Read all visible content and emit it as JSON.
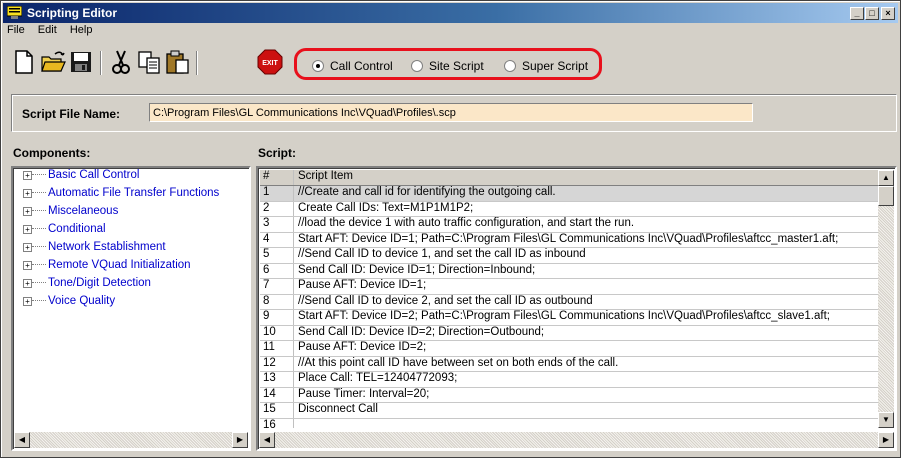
{
  "window": {
    "title": "Scripting Editor",
    "controls": [
      "_",
      "□",
      "×"
    ]
  },
  "menu": [
    {
      "label": "File",
      "key": "F"
    },
    {
      "label": "Edit",
      "key": "E"
    },
    {
      "label": "Help",
      "key": "H"
    }
  ],
  "toolbar": {
    "tools": [
      "new-file-icon",
      "open-folder-icon",
      "save-icon",
      "cut-icon",
      "copy-icon",
      "paste-icon",
      "exit-icon"
    ],
    "exit_label": "EXIT",
    "modes": [
      {
        "label": "Call Control",
        "selected": true
      },
      {
        "label": "Site Script",
        "selected": false
      },
      {
        "label": "Super Script",
        "selected": false
      }
    ]
  },
  "script_file": {
    "label": "Script File Name:",
    "value": "C:\\Program Files\\GL Communications Inc\\VQuad\\Profiles\\.scp"
  },
  "components": {
    "heading": "Components:",
    "items": [
      "Basic Call Control",
      "Automatic File Transfer Functions",
      "Miscelaneous",
      "Conditional",
      "Network Establishment",
      "Remote VQuad Initialization",
      "Tone/Digit Detection",
      "Voice Quality"
    ]
  },
  "script": {
    "heading": "Script:",
    "columns": [
      "#",
      "Script Item"
    ],
    "rows": [
      {
        "n": "1",
        "text": "//Create and call id for identifying the outgoing call."
      },
      {
        "n": "2",
        "text": "Create Call IDs: Text=M1P1M1P2;"
      },
      {
        "n": "3",
        "text": "//load the device 1 with auto traffic configuration, and start the run."
      },
      {
        "n": "4",
        "text": "Start AFT: Device ID=1; Path=C:\\Program Files\\GL Communications Inc\\VQuad\\Profiles\\aftcc_master1.aft;"
      },
      {
        "n": "5",
        "text": "//Send Call ID to device 1, and set the call ID as inbound"
      },
      {
        "n": "6",
        "text": "Send Call ID: Device ID=1; Direction=Inbound;"
      },
      {
        "n": "7",
        "text": "Pause AFT: Device ID=1;"
      },
      {
        "n": "8",
        "text": "//Send Call ID to device 2, and set the call ID as outbound"
      },
      {
        "n": "9",
        "text": "Start AFT: Device ID=2; Path=C:\\Program Files\\GL Communications Inc\\VQuad\\Profiles\\aftcc_slave1.aft;"
      },
      {
        "n": "10",
        "text": "Send Call ID: Device ID=2; Direction=Outbound;"
      },
      {
        "n": "11",
        "text": "Pause AFT: Device ID=2;"
      },
      {
        "n": "12",
        "text": "//At this point call ID have between set on both ends of the call."
      },
      {
        "n": "13",
        "text": "Place Call: TEL=12404772093;"
      },
      {
        "n": "14",
        "text": "Pause Timer: Interval=20;"
      },
      {
        "n": "15",
        "text": "Disconnect Call"
      },
      {
        "n": "16",
        "text": ""
      }
    ],
    "selected_row": 1
  },
  "colors": {
    "title_gradient_start": "#0a246a",
    "highlight": "#e8101c",
    "file_field_bg": "#fbe7c8",
    "link": "#0000cc"
  }
}
